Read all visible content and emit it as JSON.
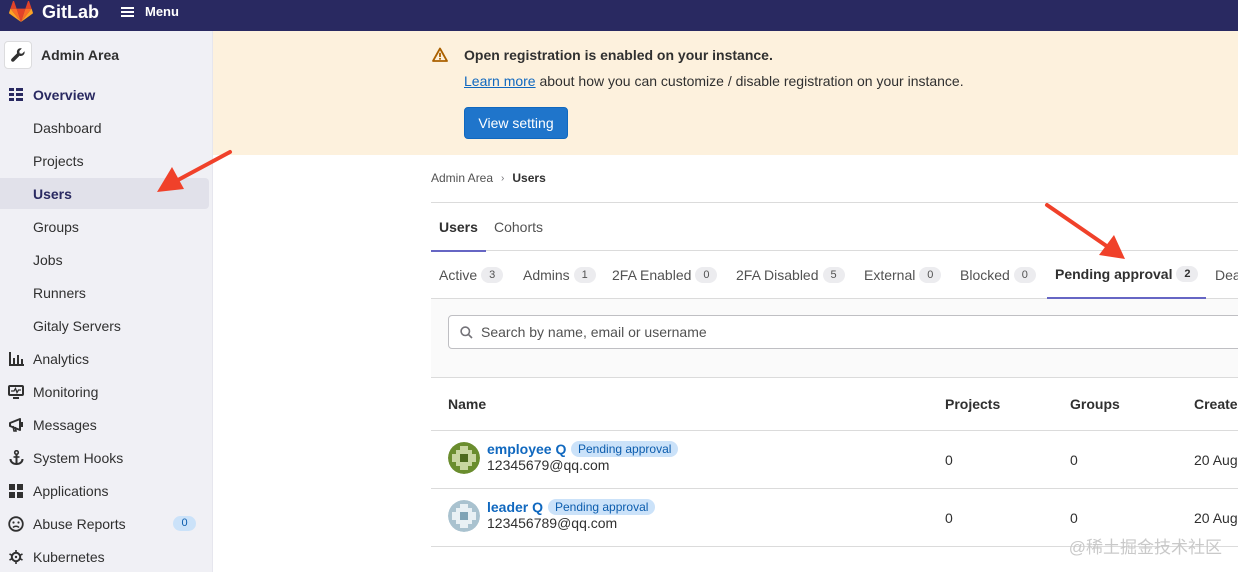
{
  "topbar": {
    "brand": "GitLab",
    "menu_label": "Menu"
  },
  "sidebar": {
    "context_title": "Admin Area",
    "overview": "Overview",
    "sub_items": [
      "Dashboard",
      "Projects",
      "Users",
      "Groups",
      "Jobs",
      "Runners",
      "Gitaly Servers"
    ],
    "items": [
      {
        "label": "Analytics",
        "icon": "chart-icon"
      },
      {
        "label": "Monitoring",
        "icon": "monitor-icon"
      },
      {
        "label": "Messages",
        "icon": "messages-icon"
      },
      {
        "label": "System Hooks",
        "icon": "anchor-icon"
      },
      {
        "label": "Applications",
        "icon": "grid-icon"
      },
      {
        "label": "Abuse Reports",
        "icon": "abuse-icon",
        "badge": "0"
      },
      {
        "label": "Kubernetes",
        "icon": "kubernetes-icon"
      }
    ]
  },
  "alert": {
    "title": "Open registration is enabled on your instance.",
    "link": "Learn more",
    "body": " about how you can customize / disable registration on your instance.",
    "button": "View setting"
  },
  "breadcrumb": {
    "parent": "Admin Area",
    "current": "Users"
  },
  "tabs": [
    "Users",
    "Cohorts"
  ],
  "filter_tabs": [
    {
      "label": "Active",
      "count": "3"
    },
    {
      "label": "Admins",
      "count": "1"
    },
    {
      "label": "2FA Enabled",
      "count": "0"
    },
    {
      "label": "2FA Disabled",
      "count": "5"
    },
    {
      "label": "External",
      "count": "0"
    },
    {
      "label": "Blocked",
      "count": "0"
    },
    {
      "label": "Pending approval",
      "count": "2"
    },
    {
      "label": "Dea"
    }
  ],
  "search": {
    "placeholder": "Search by name, email or username"
  },
  "table": {
    "headers": [
      "Name",
      "Projects",
      "Groups",
      "Create"
    ],
    "rows": [
      {
        "name": "employee Q",
        "badge": "Pending approval",
        "email": "12345679@qq.com",
        "projects": "0",
        "groups": "0",
        "created": "20 Aug"
      },
      {
        "name": "leader Q",
        "badge": "Pending approval",
        "email": "123456789@qq.com",
        "projects": "0",
        "groups": "0",
        "created": "20 Aug"
      }
    ]
  },
  "watermark": "@稀土掘金技术社区",
  "colors": {
    "topbar": "#292961",
    "sidebar": "#f0f0f5",
    "alert_bg": "#fdf1dd",
    "primary": "#1f75cb",
    "annotation": "#f0412a"
  }
}
